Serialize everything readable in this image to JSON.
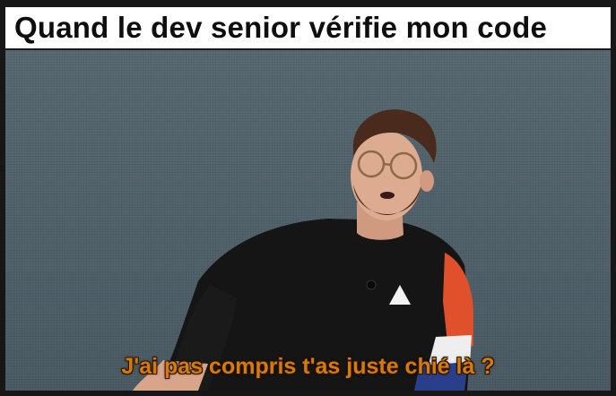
{
  "meme": {
    "top_caption": "Quand le dev senior vérifie mon code",
    "subtitle": "J'ai pas compris t'as juste chié là ?"
  },
  "colors": {
    "caption_background": "#ffffff",
    "caption_text": "#0e0e0e",
    "backdrop": "#53636c",
    "subtitle_text": "#d67a0c",
    "shirt": "#141414",
    "sleeve_accent": "#e0502a"
  }
}
